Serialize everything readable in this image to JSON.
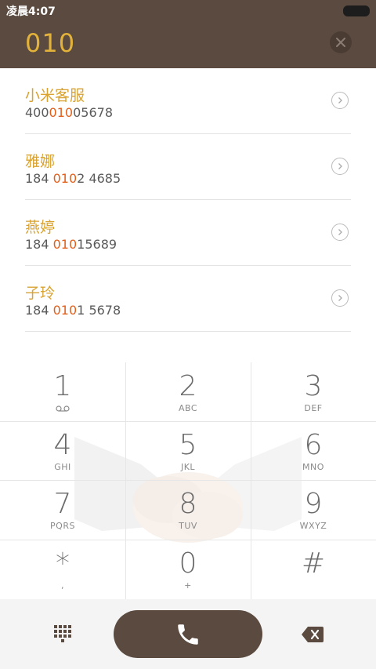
{
  "status_bar": {
    "time": "凌晨4:07"
  },
  "dialer": {
    "input_number": "010"
  },
  "contacts": [
    {
      "name": "小米客服",
      "number_prefix": "400",
      "number_match": "010",
      "number_suffix": "05678"
    },
    {
      "name": "雅娜",
      "number_prefix": "184 ",
      "number_match": "010",
      "number_suffix": "2 4685"
    },
    {
      "name": "燕婷",
      "number_prefix": "184 ",
      "number_match": "010",
      "number_suffix": "15689"
    },
    {
      "name": "子玲",
      "number_prefix": "184 ",
      "number_match": "010",
      "number_suffix": "1 5678"
    }
  ],
  "keypad": {
    "keys": [
      {
        "digit": "1",
        "letters": ""
      },
      {
        "digit": "2",
        "letters": "ABC"
      },
      {
        "digit": "3",
        "letters": "DEF"
      },
      {
        "digit": "4",
        "letters": "GHI"
      },
      {
        "digit": "5",
        "letters": "JKL"
      },
      {
        "digit": "6",
        "letters": "MNO"
      },
      {
        "digit": "7",
        "letters": "PQRS"
      },
      {
        "digit": "8",
        "letters": "TUV"
      },
      {
        "digit": "9",
        "letters": "WXYZ"
      },
      {
        "digit": "*",
        "letters": ","
      },
      {
        "digit": "0",
        "letters": "+"
      },
      {
        "digit": "#",
        "letters": ""
      }
    ]
  },
  "icons": {
    "clear": "close-icon",
    "detail": "chevron-right-circle-icon",
    "voicemail": "voicemail-icon",
    "call": "phone-icon",
    "dialpad": "dialpad-grid-icon",
    "backspace": "backspace-icon"
  },
  "colors": {
    "header_bg": "#5a4a3f",
    "number_accent": "#e2b23a",
    "name_color": "#d8a332",
    "match_highlight": "#e0601c",
    "call_button": "#5a4a3f"
  }
}
